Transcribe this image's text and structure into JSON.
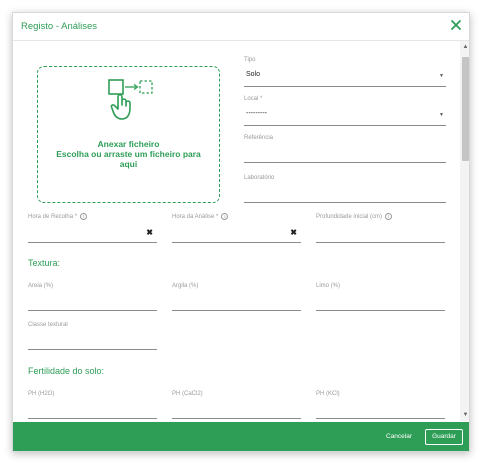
{
  "dialog": {
    "title": "Registo - Análises",
    "close_icon": "close-icon"
  },
  "upload": {
    "title": "Anexar ficheiro",
    "subtitle": "Escolha ou arraste um ficheiro para aqui",
    "icon": "drag-drop-hand-icon"
  },
  "fields": {
    "tipo": {
      "label": "Tipo",
      "value": "Solo"
    },
    "local": {
      "label": "Local *",
      "value": "---------"
    },
    "referencia": {
      "label": "Referência",
      "value": ""
    },
    "laboratorio": {
      "label": "Laboratório",
      "value": ""
    },
    "hora_recolha": {
      "label": "Hora de Recolha *",
      "value": ""
    },
    "hora_analise": {
      "label": "Hora da Análise *",
      "value": ""
    },
    "profundidade": {
      "label": "Profundidade inicial (cm)",
      "value": ""
    },
    "areia": {
      "label": "Areia (%)",
      "value": ""
    },
    "argila": {
      "label": "Argila (%)",
      "value": ""
    },
    "limo": {
      "label": "Limo (%)",
      "value": ""
    },
    "classe_textural": {
      "label": "Classe textural",
      "value": ""
    },
    "ph_h2o": {
      "label": "PH (H2O)",
      "value": ""
    },
    "ph_cacl2": {
      "label": "PH (CaCl2)",
      "value": ""
    },
    "ph_kcl": {
      "label": "PH (KCl)",
      "value": ""
    }
  },
  "sections": {
    "textura": "Textura:",
    "fertilidade": "Fertilidade do solo:"
  },
  "footer": {
    "cancel": "Cancelar",
    "save": "Guardar"
  },
  "colors": {
    "accent": "#2e9e57",
    "label": "#9a9a9a",
    "underline": "#8a8a8a"
  }
}
